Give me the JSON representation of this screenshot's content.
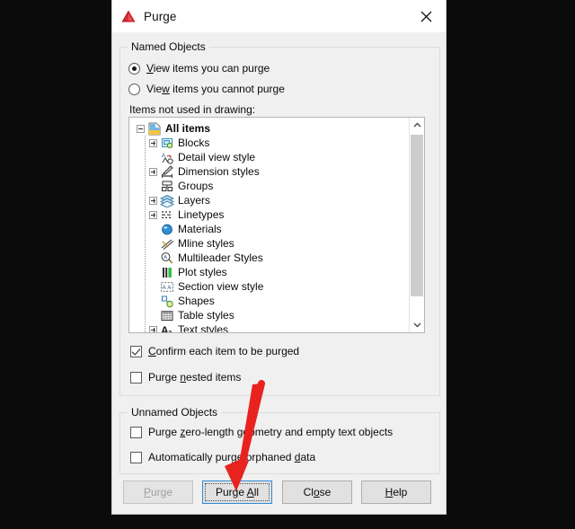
{
  "window": {
    "title": "Purge",
    "logo_icon": "autocad-red-triangle-icon",
    "close_icon": "close-icon"
  },
  "named_objects": {
    "group_label": "Named Objects",
    "radios": [
      {
        "label": "View items you can purge",
        "mnemonic": "V",
        "selected": true
      },
      {
        "label": "View items you cannot purge",
        "mnemonic": "w",
        "selected": false
      }
    ],
    "list_label": "Items not used in drawing:",
    "tree": [
      {
        "label": "All items",
        "level": 0,
        "expander": "minus",
        "icon": "all-items-icon",
        "bold": true
      },
      {
        "label": "Blocks",
        "level": 1,
        "expander": "plus",
        "icon": "blocks-icon",
        "bold": false
      },
      {
        "label": "Detail view style",
        "level": 1,
        "expander": "none",
        "icon": "detail-view-style-icon",
        "bold": false
      },
      {
        "label": "Dimension styles",
        "level": 1,
        "expander": "plus",
        "icon": "dimension-styles-icon",
        "bold": false
      },
      {
        "label": "Groups",
        "level": 1,
        "expander": "none",
        "icon": "groups-icon",
        "bold": false
      },
      {
        "label": "Layers",
        "level": 1,
        "expander": "plus",
        "icon": "layers-icon",
        "bold": false
      },
      {
        "label": "Linetypes",
        "level": 1,
        "expander": "plus",
        "icon": "linetypes-icon",
        "bold": false
      },
      {
        "label": "Materials",
        "level": 1,
        "expander": "none",
        "icon": "materials-icon",
        "bold": false
      },
      {
        "label": "Mline styles",
        "level": 1,
        "expander": "none",
        "icon": "mline-styles-icon",
        "bold": false
      },
      {
        "label": "Multileader Styles",
        "level": 1,
        "expander": "none",
        "icon": "multileader-styles-icon",
        "bold": false
      },
      {
        "label": "Plot styles",
        "level": 1,
        "expander": "none",
        "icon": "plot-styles-icon",
        "bold": false
      },
      {
        "label": "Section view style",
        "level": 1,
        "expander": "none",
        "icon": "section-view-style-icon",
        "bold": false
      },
      {
        "label": "Shapes",
        "level": 1,
        "expander": "none",
        "icon": "shapes-icon",
        "bold": false
      },
      {
        "label": "Table styles",
        "level": 1,
        "expander": "none",
        "icon": "table-styles-icon",
        "bold": false
      },
      {
        "label": "Text styles",
        "level": 1,
        "expander": "plus",
        "icon": "text-styles-icon",
        "bold": false
      }
    ],
    "scrollbar": {
      "up_icon": "chevron-up-icon",
      "down_icon": "chevron-down-icon"
    },
    "checkboxes": [
      {
        "label": "Confirm each item to be purged",
        "mnemonic": "C",
        "checked": true
      },
      {
        "label": "Purge nested items",
        "mnemonic": "n",
        "checked": false
      }
    ]
  },
  "unnamed_objects": {
    "group_label": "Unnamed Objects",
    "checkboxes": [
      {
        "label": "Purge zero-length geometry and empty text objects",
        "mnemonic": "z",
        "checked": false
      },
      {
        "label": "Automatically purge orphaned data",
        "mnemonic": "d",
        "checked": false
      }
    ]
  },
  "buttons": [
    {
      "label": "Purge",
      "mnemonic": "P",
      "state": "disabled"
    },
    {
      "label": "Purge All",
      "mnemonic": "A",
      "state": "default"
    },
    {
      "label": "Close",
      "mnemonic": "o",
      "state": "normal"
    },
    {
      "label": "Help",
      "mnemonic": "H",
      "state": "normal"
    }
  ],
  "annotation": {
    "arrow_icon": "red-arrow-annotation",
    "color": "#e8231f",
    "points_to": "Purge All"
  },
  "colors": {
    "dialog_bg": "#f0f0f0",
    "titlebar_bg": "#ffffff",
    "list_bg": "#ffffff",
    "accent_focus": "#2d8ad6",
    "annotation_red": "#e8231f",
    "backdrop": "#0b0b0b"
  }
}
